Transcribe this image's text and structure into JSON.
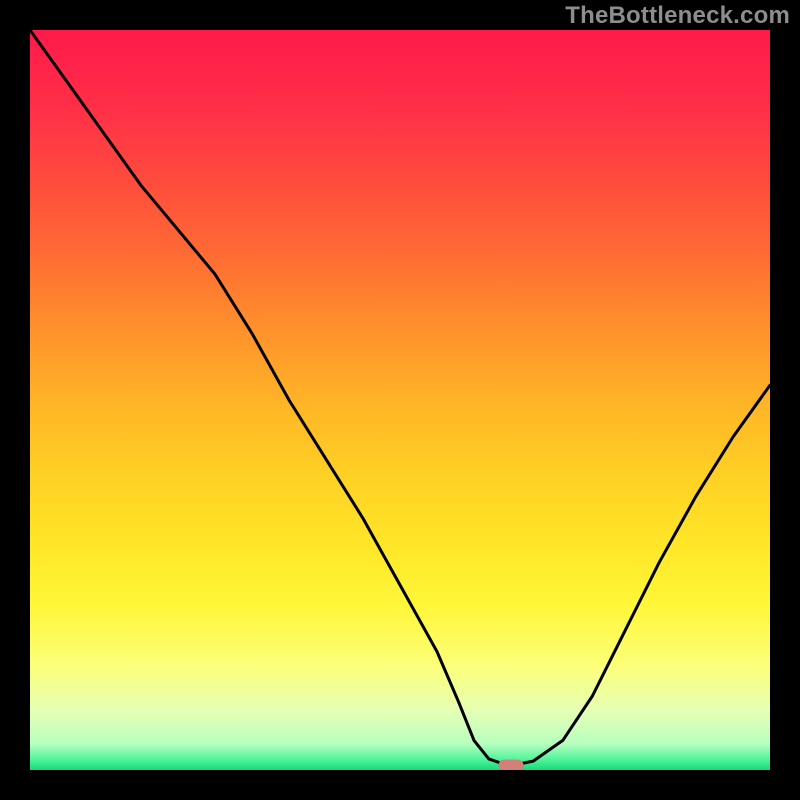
{
  "watermark": "TheBottleneck.com",
  "colors": {
    "frame_background": "#000000",
    "curve_stroke": "#000000",
    "marker_fill": "#d38079"
  },
  "gradient_stops": [
    {
      "offset": 0.0,
      "color": "#ff1a4a"
    },
    {
      "offset": 0.1,
      "color": "#ff2e48"
    },
    {
      "offset": 0.2,
      "color": "#ff4a3e"
    },
    {
      "offset": 0.3,
      "color": "#ff6a34"
    },
    {
      "offset": 0.4,
      "color": "#ff8f2c"
    },
    {
      "offset": 0.5,
      "color": "#ffb327"
    },
    {
      "offset": 0.6,
      "color": "#ffd024"
    },
    {
      "offset": 0.7,
      "color": "#ffe728"
    },
    {
      "offset": 0.78,
      "color": "#fff73a"
    },
    {
      "offset": 0.86,
      "color": "#fbff7a"
    },
    {
      "offset": 0.92,
      "color": "#e6ffb4"
    },
    {
      "offset": 0.965,
      "color": "#b6ffc0"
    },
    {
      "offset": 0.985,
      "color": "#54f59c"
    },
    {
      "offset": 1.0,
      "color": "#15d978"
    }
  ],
  "chart_data": {
    "type": "line",
    "title": "",
    "xlabel": "",
    "ylabel": "",
    "xlim": [
      0,
      100
    ],
    "ylim": [
      0,
      100
    ],
    "grid": false,
    "legend": false,
    "series": [
      {
        "name": "bottleneck_percent",
        "x": [
          0,
          5,
          10,
          15,
          20,
          25,
          30,
          35,
          40,
          45,
          50,
          55,
          58,
          60,
          62,
          64,
          65,
          68,
          72,
          76,
          80,
          85,
          90,
          95,
          100
        ],
        "y": [
          100,
          93,
          86,
          79,
          73,
          67,
          59,
          50,
          42,
          34,
          25,
          16,
          9,
          4,
          1.5,
          0.8,
          0.6,
          1.2,
          4,
          10,
          18,
          28,
          37,
          45,
          52
        ]
      }
    ],
    "annotations": [
      {
        "name": "optimal_point",
        "x": 65,
        "y": 0.6
      }
    ],
    "marker": {
      "x": 65,
      "y": 0.6,
      "width_pct": 3.4,
      "height_pct": 1.6
    }
  }
}
